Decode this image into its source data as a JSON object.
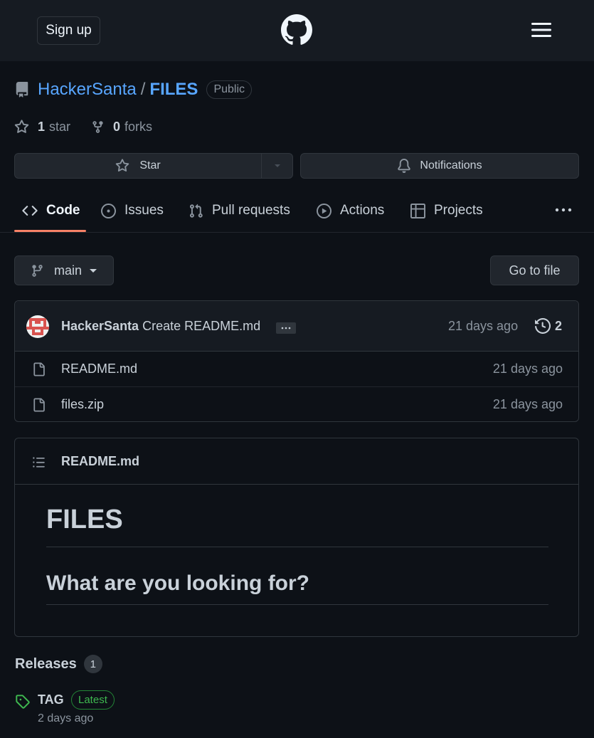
{
  "header": {
    "signup_label": "Sign up",
    "logo_icon": "github-mark-icon",
    "menu_icon": "hamburger-menu-icon"
  },
  "repo": {
    "owner": "HackerSanta",
    "separator": "/",
    "name": "FILES",
    "visibility": "Public",
    "stars_count": "1",
    "stars_label": "star",
    "forks_count": "0",
    "forks_label": "forks"
  },
  "actions": {
    "star_label": "Star",
    "notifications_label": "Notifications"
  },
  "tabs": [
    {
      "label": "Code",
      "icon": "code-icon",
      "active": true
    },
    {
      "label": "Issues",
      "icon": "issue-opened-icon"
    },
    {
      "label": "Pull requests",
      "icon": "git-pull-request-icon"
    },
    {
      "label": "Actions",
      "icon": "play-icon"
    },
    {
      "label": "Projects",
      "icon": "table-icon"
    }
  ],
  "toolbar": {
    "branch": "main",
    "go_to_file_label": "Go to file"
  },
  "commit": {
    "author": "HackerSanta",
    "message": "Create README.md",
    "time": "21 days ago",
    "history_count": "2"
  },
  "files": [
    {
      "name": "README.md",
      "time": "21 days ago"
    },
    {
      "name": "files.zip",
      "time": "21 days ago"
    }
  ],
  "readme": {
    "filename": "README.md",
    "h1": "FILES",
    "h2": "What are you looking for?"
  },
  "releases": {
    "title": "Releases",
    "count": "1",
    "tag_name": "TAG",
    "tag_badge": "Latest",
    "tag_time": "2 days ago"
  },
  "colors": {
    "background": "#0d1117",
    "header_bg": "#161b22",
    "link": "#58a6ff",
    "accent_underline": "#f78166",
    "latest_green": "#3fb950"
  }
}
